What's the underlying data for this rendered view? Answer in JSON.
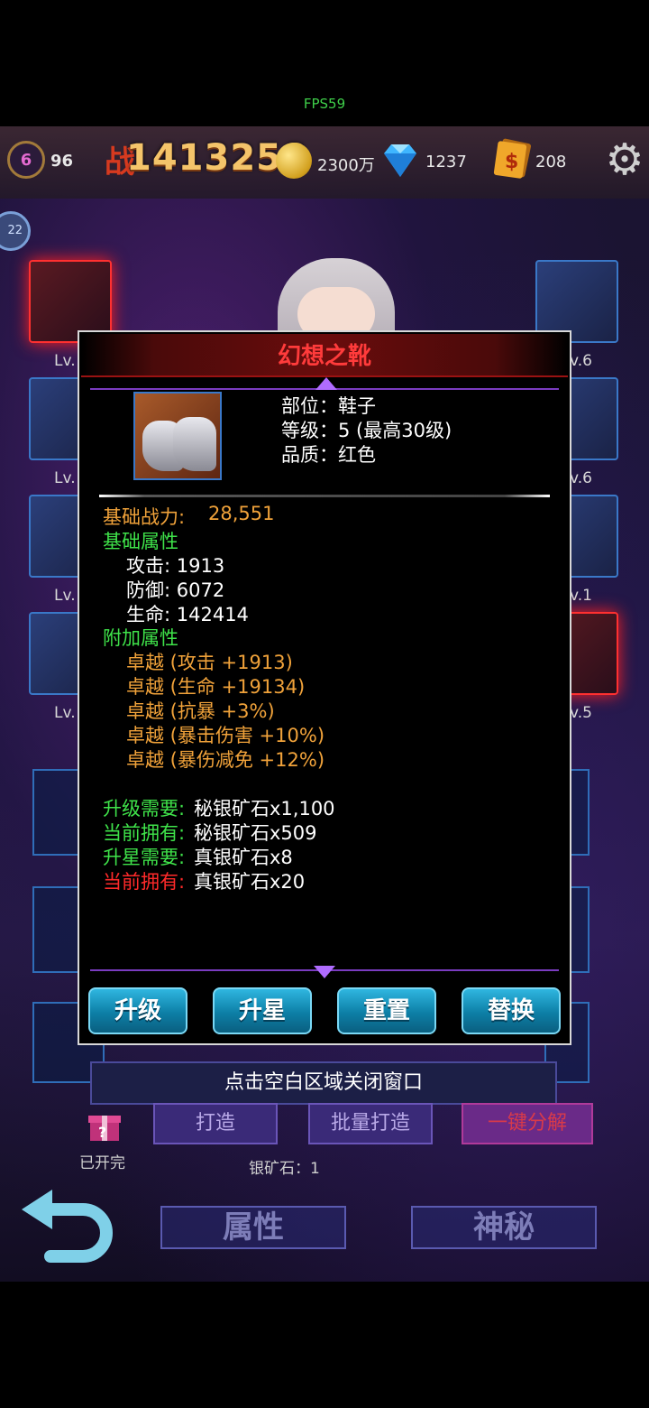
{
  "status": {
    "fps": "FPS59"
  },
  "header": {
    "level": "6",
    "level_sub": "96",
    "power_icon": "战",
    "power": "1413258",
    "coins": "2300万",
    "gems": "1237",
    "cash": "208",
    "icons": [
      "level-badge-icon",
      "power-icon",
      "coin-icon",
      "diamond-icon",
      "cash-card-icon",
      "gear-icon"
    ]
  },
  "side_slots": {
    "left_labels": [
      "Lv.",
      "Lv.",
      "Lv.",
      "Lv."
    ],
    "right_labels": [
      "v.6",
      "v.6",
      "v.1",
      "v.5"
    ],
    "badge": "22"
  },
  "modal": {
    "title": "幻想之靴",
    "info": {
      "slot": "部位：鞋子",
      "level": "等级：5  (最高30级)",
      "quality": "品质：红色"
    },
    "base_power_label": "基础战力:",
    "base_power_value": "28,551",
    "base_attr_title": "基础属性",
    "base_attrs": [
      "攻击:  1913",
      "防御:  6072",
      "生命:  142414"
    ],
    "extra_attr_title": "附加属性",
    "extra_attrs": [
      "卓越 (攻击 +1913)",
      "卓越 (生命 +19134)",
      "卓越 (抗暴 +3%)",
      "卓越 (暴击伤害 +10%)",
      "卓越 (暴伤减免 +12%)"
    ],
    "requirements": [
      {
        "label": "升级需要:",
        "value": "秘银矿石x1,100"
      },
      {
        "label": "当前拥有:",
        "value": "秘银矿石x509"
      },
      {
        "label": "升星需要:",
        "value": "真银矿石x8"
      },
      {
        "label": "当前拥有:",
        "value": "真银矿石x20"
      }
    ],
    "buttons": [
      "升级",
      "升星",
      "重置",
      "替换"
    ]
  },
  "bottom": {
    "close_hint": "点击空白区域关闭窗口",
    "gift_label": "已开完",
    "forge": "打造",
    "batch_forge": "批量打造",
    "one_key": "一键分解",
    "ore_label": "银矿石：1",
    "tab_attr": "属性",
    "tab_mystery": "神秘"
  },
  "colors": {
    "title_red": "#ff3b3b",
    "orange": "#f0a23a",
    "green": "#3fe34a",
    "red": "#ff2a2a",
    "button_cyan": "#1a9cc8"
  }
}
